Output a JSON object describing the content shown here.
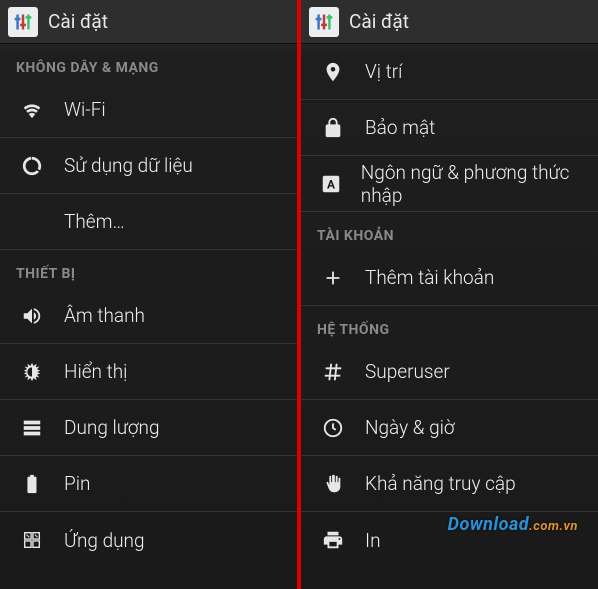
{
  "app_title": "Cài đặt",
  "left": {
    "sections": {
      "wireless": {
        "header": "KHÔNG DÂY & MẠNG",
        "items": {
          "wifi": "Wi-Fi",
          "data_usage": "Sử dụng dữ liệu",
          "more": "Thêm…"
        }
      },
      "device": {
        "header": "THIẾT BỊ",
        "items": {
          "sound": "Âm thanh",
          "display": "Hiển thị",
          "storage": "Dung lượng",
          "battery": "Pin",
          "apps": "Ứng dụng"
        }
      }
    }
  },
  "right": {
    "sections": {
      "top": {
        "items": {
          "location": "Vị trí",
          "security": "Bảo mật",
          "language": "Ngôn ngữ & phương thức nhập"
        }
      },
      "accounts": {
        "header": "TÀI KHOẢN",
        "items": {
          "add_account": "Thêm tài khoản"
        }
      },
      "system": {
        "header": "HỆ THỐNG",
        "items": {
          "superuser": "Superuser",
          "datetime": "Ngày & giờ",
          "accessibility": "Khả năng truy cập",
          "print": "In"
        }
      }
    }
  },
  "watermark": {
    "brand": "Download",
    "suffix": ".com.vn"
  }
}
